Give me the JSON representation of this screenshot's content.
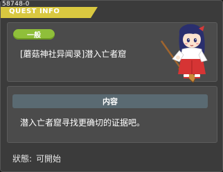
{
  "window": {
    "quest_id": "58748-0",
    "title": "QUEST INFO"
  },
  "quest": {
    "category_badge": "一般",
    "name": "[蘑菇神社异闻录]潜入亡者窟"
  },
  "content": {
    "header": "内容",
    "text": "潜入亡者窟寻找更确切的证据吧。"
  },
  "status": {
    "label": "狀態:",
    "value": "可開始"
  },
  "colors": {
    "badge": "#8fbf3a",
    "title_underline": "#d9c840",
    "content_header": "#5a6a72"
  },
  "icons": {
    "npc": "shrine-maiden-npc-with-broom"
  }
}
